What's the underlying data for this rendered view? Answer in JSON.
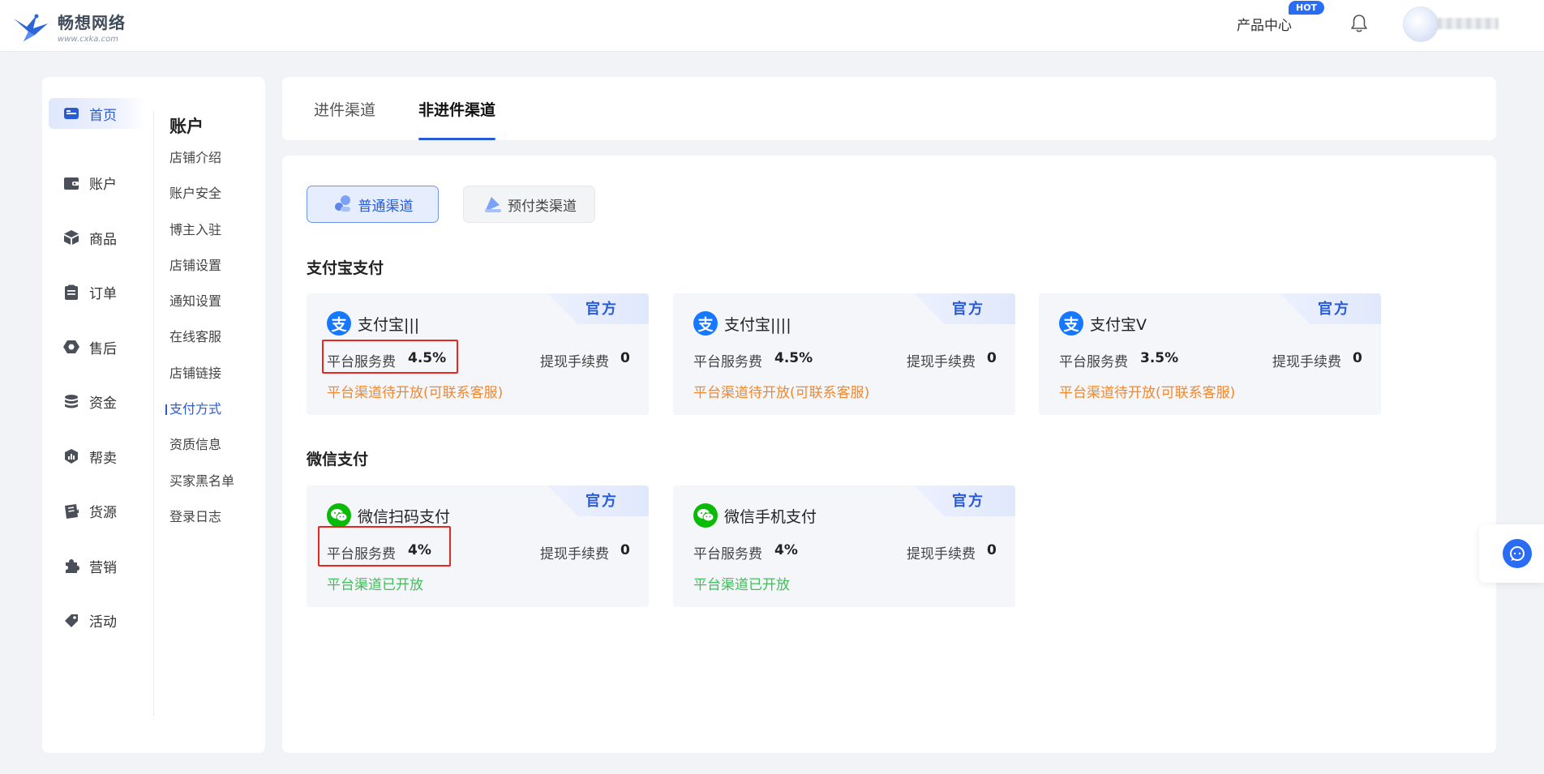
{
  "header": {
    "logo_name": "畅想网络",
    "logo_url": "www.cxka.com",
    "product_center": "产品中心",
    "hot_badge": "HOT"
  },
  "sidebar": {
    "items": [
      {
        "label": "首页",
        "icon": "store-icon",
        "active": true
      },
      {
        "label": "账户",
        "icon": "wallet-icon"
      },
      {
        "label": "商品",
        "icon": "box-icon"
      },
      {
        "label": "订单",
        "icon": "clipboard-icon"
      },
      {
        "label": "售后",
        "icon": "hexagon-icon"
      },
      {
        "label": "资金",
        "icon": "coins-icon"
      },
      {
        "label": "帮卖",
        "icon": "chart-shield-icon"
      },
      {
        "label": "货源",
        "icon": "source-icon"
      },
      {
        "label": "营销",
        "icon": "puzzle-icon"
      },
      {
        "label": "活动",
        "icon": "tag-icon"
      }
    ]
  },
  "submenu": {
    "title": "账户",
    "items": [
      "店铺介绍",
      "账户安全",
      "博主入驻",
      "店铺设置",
      "通知设置",
      "在线客服",
      "店铺链接",
      "支付方式",
      "资质信息",
      "买家黑名单",
      "登录日志"
    ],
    "active_index": 7
  },
  "tabs": [
    {
      "label": "进件渠道"
    },
    {
      "label": "非进件渠道",
      "active": true
    }
  ],
  "channel_type": {
    "normal": "普通渠道",
    "prepaid": "预付类渠道"
  },
  "sections": {
    "alipay_title": "支付宝支付",
    "wechat_title": "微信支付"
  },
  "common": {
    "official": "官方",
    "platform_fee_label": "平台服务费",
    "withdraw_fee_label": "提现手续费"
  },
  "alipay_cards": [
    {
      "name": "支付宝|||",
      "platform_fee": "4.5%",
      "withdraw_fee": "0",
      "status": "平台渠道待开放(可联系客服)"
    },
    {
      "name": "支付宝||||",
      "platform_fee": "4.5%",
      "withdraw_fee": "0",
      "status": "平台渠道待开放(可联系客服)"
    },
    {
      "name": "支付宝V",
      "platform_fee": "3.5%",
      "withdraw_fee": "0",
      "status": "平台渠道待开放(可联系客服)"
    }
  ],
  "wechat_cards": [
    {
      "name": "微信扫码支付",
      "platform_fee": "4%",
      "withdraw_fee": "0",
      "status": "平台渠道已开放"
    },
    {
      "name": "微信手机支付",
      "platform_fee": "4%",
      "withdraw_fee": "0",
      "status": "平台渠道已开放"
    }
  ],
  "colors": {
    "accent": "#2a5bd7",
    "pending": "#f0882f",
    "open": "#3fbf5a",
    "highlight": "#e8281f"
  }
}
